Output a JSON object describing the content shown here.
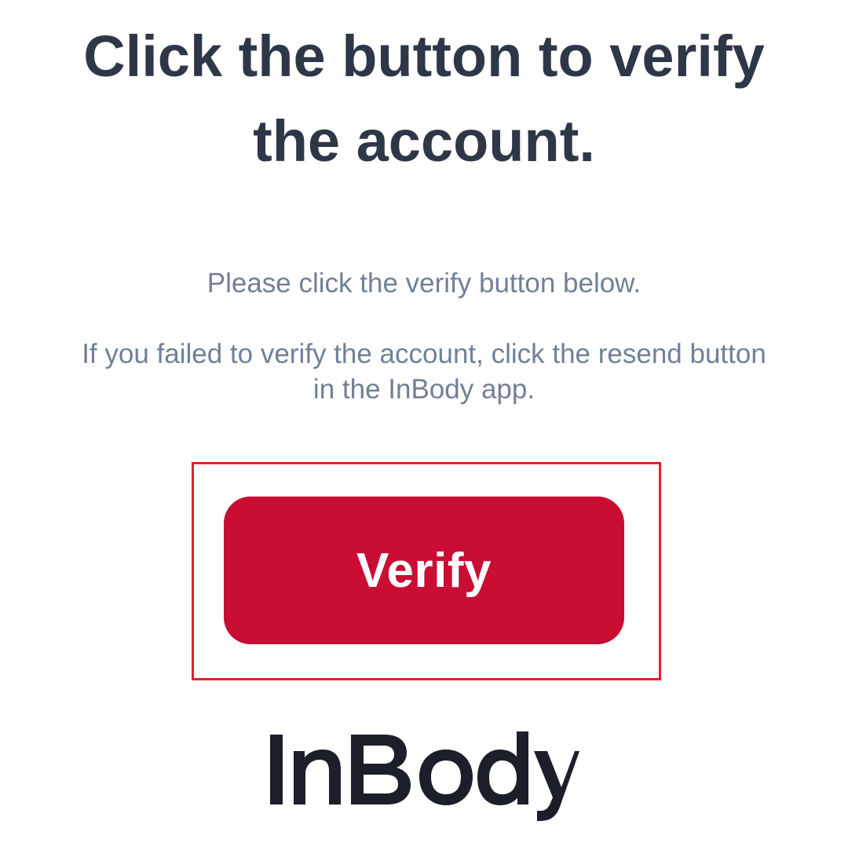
{
  "heading": {
    "line1": "Click the button to verify",
    "line2": "the account."
  },
  "message": {
    "line1": "Please click the verify button below.",
    "line2": "If you failed to verify the account, click the resend button",
    "line3": "in the InBody app."
  },
  "button": {
    "label": "Verify",
    "color": "#c90d33",
    "text_color": "#ffffff"
  },
  "highlight": {
    "color": "#e8202e"
  },
  "logo": {
    "text": "InBody",
    "color": "#1c1f2a"
  }
}
